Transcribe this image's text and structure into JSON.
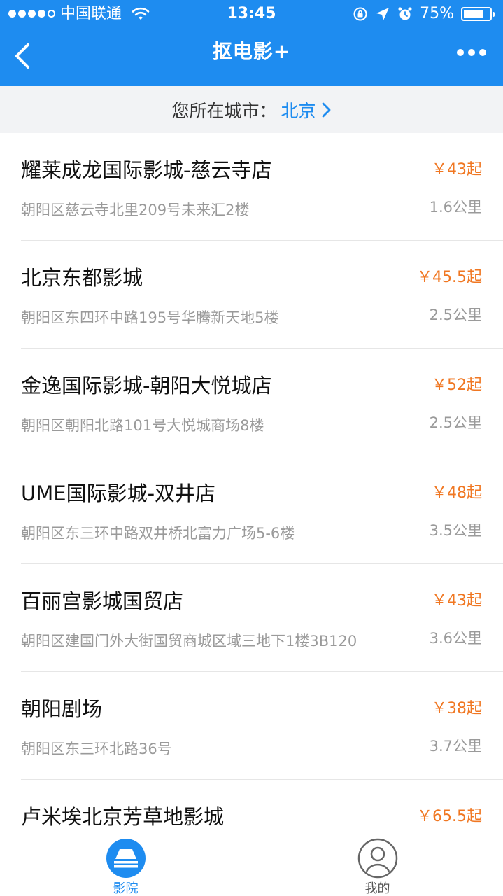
{
  "status_bar": {
    "carrier": "中国联通",
    "time": "13:45",
    "battery": "75%",
    "battery_level": 0.75
  },
  "nav": {
    "title": "抠电影+"
  },
  "city": {
    "label": "您所在城市：",
    "name": "北京"
  },
  "cinemas": [
    {
      "name": "耀莱成龙国际影城-慈云寺店",
      "price": "￥43起",
      "address": "朝阳区慈云寺北里209号未来汇2楼",
      "distance": "1.6公里"
    },
    {
      "name": "北京东都影城",
      "price": "￥45.5起",
      "address": "朝阳区东四环中路195号华腾新天地5楼",
      "distance": "2.5公里"
    },
    {
      "name": "金逸国际影城-朝阳大悦城店",
      "price": "￥52起",
      "address": "朝阳区朝阳北路101号大悦城商场8楼",
      "distance": "2.5公里"
    },
    {
      "name": "UME国际影城-双井店",
      "price": "￥48起",
      "address": "朝阳区东三环中路双井桥北富力广场5-6楼",
      "distance": "3.5公里"
    },
    {
      "name": "百丽宫影城国贸店",
      "price": "￥43起",
      "address": "朝阳区建国门外大街国贸商城区域三地下1楼3B120",
      "distance": "3.6公里"
    },
    {
      "name": "朝阳剧场",
      "price": "￥38起",
      "address": "朝阳区东三环北路36号",
      "distance": "3.7公里"
    },
    {
      "name": "卢米埃北京芳草地影城",
      "price": "￥65.5起",
      "address": "",
      "distance": ""
    }
  ],
  "tabs": [
    {
      "label": "影院",
      "active": true
    },
    {
      "label": "我的",
      "active": false
    }
  ],
  "colors": {
    "primary": "#1E8CF0",
    "price": "#F07722",
    "secondary_text": "#9A9A9A"
  }
}
